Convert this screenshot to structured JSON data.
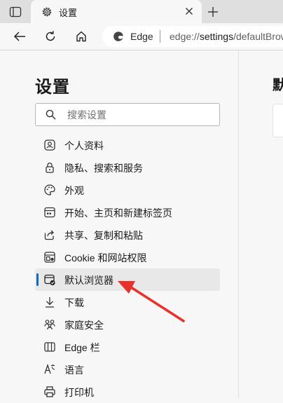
{
  "tab": {
    "title": "设置",
    "favicon": "gear-icon"
  },
  "toolbar": {
    "site_label": "Edge",
    "url_prefix": "edge://",
    "url_bold": "settings",
    "url_rest": "/defaultBrowser"
  },
  "sidebar": {
    "title": "设置",
    "search_placeholder": "搜索设置",
    "items": [
      {
        "label": "个人资料",
        "icon": "profile-icon"
      },
      {
        "label": "隐私、搜索和服务",
        "icon": "lock-icon"
      },
      {
        "label": "外观",
        "icon": "palette-icon"
      },
      {
        "label": "开始、主页和新建标签页",
        "icon": "start-page-icon"
      },
      {
        "label": "共享、复制和粘贴",
        "icon": "share-icon"
      },
      {
        "label": "Cookie 和网站权限",
        "icon": "site-permissions-icon"
      },
      {
        "label": "默认浏览器",
        "icon": "default-browser-icon",
        "active": true
      },
      {
        "label": "下载",
        "icon": "download-icon"
      },
      {
        "label": "家庭安全",
        "icon": "family-icon"
      },
      {
        "label": "Edge 栏",
        "icon": "edge-bar-icon"
      },
      {
        "label": "语言",
        "icon": "language-icon"
      },
      {
        "label": "打印机",
        "icon": "printer-icon"
      }
    ]
  },
  "main": {
    "page_title": "默认浏览器"
  },
  "colors": {
    "accent": "#0f6cbd",
    "annotation_arrow": "#e8312a"
  }
}
